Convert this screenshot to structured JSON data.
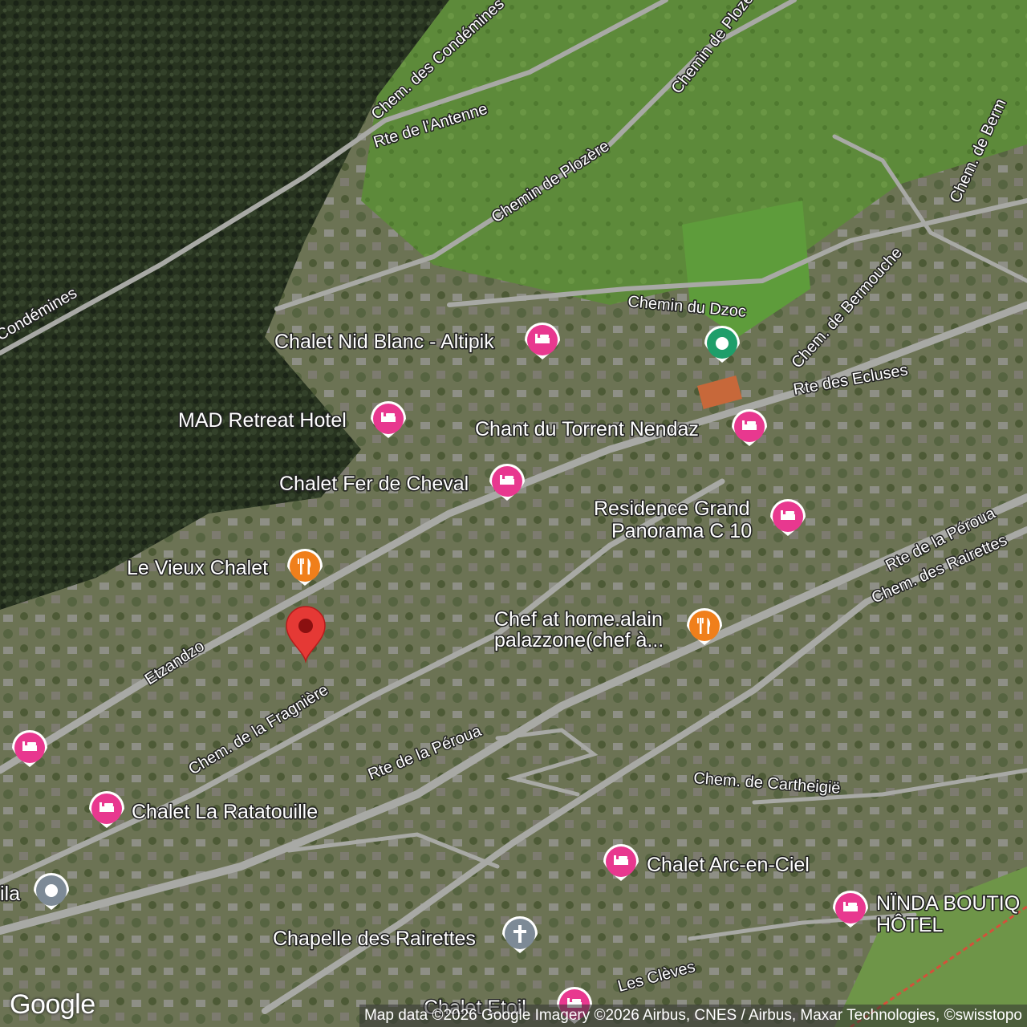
{
  "roads": [
    {
      "id": "chem-des-condemines",
      "label": "Chem. des Condémines"
    },
    {
      "id": "chem-des-condemines-2",
      "label": "Condémines"
    },
    {
      "id": "rte-de-l-antenne",
      "label": "Rte de l'Antenne"
    },
    {
      "id": "chemin-de-plozere",
      "label": "Chemin de Plozère"
    },
    {
      "id": "chemin-de-plozere-2",
      "label": "Chemin de Plozère"
    },
    {
      "id": "chem-de-bermouche",
      "label": "Chem. de Bermouche"
    },
    {
      "id": "chem-de-bermouche-2",
      "label": "Chem. de Berm"
    },
    {
      "id": "chemin-du-dzoc",
      "label": "Chemin du Dzoc"
    },
    {
      "id": "rte-des-ecluses",
      "label": "Rte des Ecluses"
    },
    {
      "id": "rte-de-la-peroua",
      "label": "Rte de la Péroua"
    },
    {
      "id": "rte-de-la-peroua-2",
      "label": "Rte de la Péroua"
    },
    {
      "id": "chem-des-rairettes",
      "label": "Chem. des Rairettes"
    },
    {
      "id": "etzandzo",
      "label": "Etzandzo"
    },
    {
      "id": "chem-de-la-fragniere",
      "label": "Chem. de la Fragnière"
    },
    {
      "id": "chem-de-cartheigie",
      "label": "Chem. de Cartheigië"
    },
    {
      "id": "les-cleves",
      "label": "Les Clèves"
    }
  ],
  "pois": [
    {
      "id": "chalet-nid-blanc",
      "label": "Chalet Nid Blanc - Altipik",
      "type": "hotel",
      "icon": "bed-icon",
      "color": "#e8388f"
    },
    {
      "id": "mad-retreat",
      "label": "MAD Retreat Hotel",
      "type": "hotel",
      "icon": "bed-icon",
      "color": "#e8388f"
    },
    {
      "id": "chant-du-torrent",
      "label": "Chant du Torrent Nendaz",
      "type": "hotel",
      "icon": "bed-icon",
      "color": "#e8388f"
    },
    {
      "id": "chalet-fer-de-cheval",
      "label": "Chalet Fer de Cheval",
      "type": "hotel",
      "icon": "bed-icon",
      "color": "#e8388f"
    },
    {
      "id": "residence-grand-panorama",
      "label": "Residence Grand",
      "label2": "Panorama C 10",
      "type": "hotel",
      "icon": "bed-icon",
      "color": "#e8388f"
    },
    {
      "id": "le-vieux-chalet",
      "label": "Le Vieux Chalet",
      "type": "restaurant",
      "icon": "fork-knife-icon",
      "color": "#f07f1b"
    },
    {
      "id": "chef-at-home",
      "label": "Chef at home.alain",
      "label2": "palazzone(chef à...",
      "type": "restaurant",
      "icon": "fork-knife-icon",
      "color": "#f07f1b"
    },
    {
      "id": "chalet-la-ratatouille",
      "label": "Chalet La Ratatouille",
      "type": "hotel",
      "icon": "bed-icon",
      "color": "#e8388f"
    },
    {
      "id": "unnamed-hotel-left",
      "label": "",
      "type": "hotel",
      "icon": "bed-icon",
      "color": "#e8388f"
    },
    {
      "id": "chalet-arc-en-ciel",
      "label": "Chalet Arc-en-Ciel",
      "type": "hotel",
      "icon": "bed-icon",
      "color": "#e8388f"
    },
    {
      "id": "ninda-boutique",
      "label": "NÏNDA BOUTIQ",
      "label2": "HÔTEL",
      "type": "hotel",
      "icon": "bed-icon",
      "color": "#e8388f"
    },
    {
      "id": "chapelle-des-rairettes",
      "label": "Chapelle des Rairettes",
      "type": "church",
      "icon": "cross-icon",
      "color": "#7d8a96"
    },
    {
      "id": "ila-place",
      "label": "ila",
      "type": "place",
      "icon": "dot-icon",
      "color": "#7d8a96"
    },
    {
      "id": "park-green",
      "label": "",
      "type": "park",
      "icon": "dot-icon",
      "color": "#1e9e6a"
    },
    {
      "id": "chalet-etoile",
      "label": "Chalet Etoil",
      "type": "hotel",
      "icon": "bed-icon",
      "color": "#e8388f"
    }
  ],
  "selected_pin": {
    "icon": "map-pin-icon",
    "color": "#e53935"
  },
  "attribution": "Map data ©2026 Google Imagery ©2026 Airbus, CNES / Airbus, Maxar Technologies, ©swisstopo",
  "google_logo": "Google"
}
